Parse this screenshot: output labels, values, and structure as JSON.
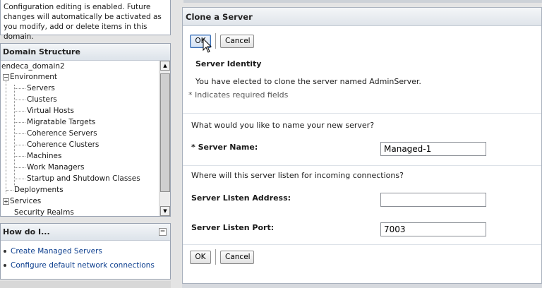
{
  "change_center": {
    "message": "Configuration editing is enabled. Future changes will automatically be activated as you modify, add or delete items in this domain."
  },
  "domain_structure": {
    "title": "Domain Structure",
    "root": "endeca_domain2",
    "environment": "Environment",
    "env_items": [
      "Servers",
      "Clusters",
      "Virtual Hosts",
      "Migratable Targets",
      "Coherence Servers",
      "Coherence Clusters",
      "Machines",
      "Work Managers",
      "Startup and Shutdown Classes"
    ],
    "deployments": "Deployments",
    "services": "Services",
    "security_realms": "Security Realms"
  },
  "how_do_i": {
    "title": "How do I...",
    "links": [
      "Create Managed Servers",
      "Configure default network connections"
    ]
  },
  "main": {
    "title": "Clone a Server",
    "ok_label": "OK",
    "cancel_label": "Cancel",
    "section_title": "Server Identity",
    "clone_message": "You have elected to clone the server named AdminServer.",
    "required_note": "* Indicates required fields",
    "name_question": "What would you like to name your new server?",
    "server_name_label": "* Server Name:",
    "server_name_value": "Managed-1",
    "listen_question": "Where will this server listen for incoming connections?",
    "listen_address_label": "Server Listen Address:",
    "listen_address_value": "",
    "listen_port_label": "Server Listen Port:",
    "listen_port_value": "7003"
  },
  "icons": {
    "expand": "minus-box-icon",
    "collapsed": "plus-box-icon",
    "scroll_up": "arrow-up-icon",
    "scroll_down": "arrow-down-icon",
    "cursor": "mouse-pointer-icon"
  }
}
